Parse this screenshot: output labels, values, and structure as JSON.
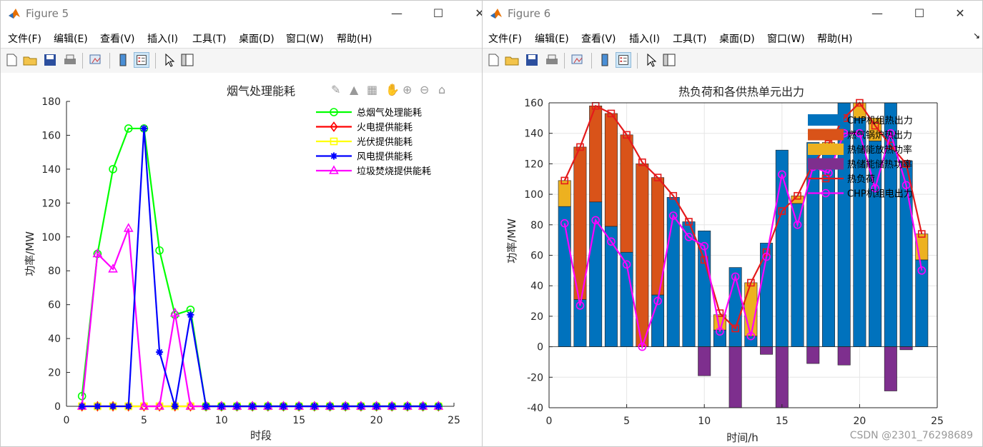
{
  "fig5": {
    "title": "Figure 5",
    "menu": [
      "文件(F)",
      "编辑(E)",
      "查看(V)",
      "插入(I)",
      "工具(T)",
      "桌面(D)",
      "窗口(W)",
      "帮助(H)"
    ],
    "chart_data": {
      "type": "line",
      "title": "烟气处理能耗",
      "xlabel": "时段",
      "ylabel": "功率/MW",
      "xlim": [
        0,
        25
      ],
      "ylim": [
        0,
        180
      ],
      "xticks": [
        0,
        5,
        10,
        15,
        20,
        25
      ],
      "yticks": [
        0,
        20,
        40,
        60,
        80,
        100,
        120,
        140,
        160,
        180
      ],
      "x": [
        1,
        2,
        3,
        4,
        5,
        6,
        7,
        8,
        9,
        10,
        11,
        12,
        13,
        14,
        15,
        16,
        17,
        18,
        19,
        20,
        21,
        22,
        23,
        24
      ],
      "series": [
        {
          "name": "总烟气处理能耗",
          "color": "#00ff00",
          "marker": "circle",
          "values": [
            6,
            90,
            140,
            164,
            164,
            92,
            54,
            57,
            0,
            0,
            0,
            0,
            0,
            0,
            0,
            0,
            0,
            0,
            0,
            0,
            0,
            0,
            0,
            0
          ]
        },
        {
          "name": "火电提供能耗",
          "color": "#ff0000",
          "marker": "diamond",
          "values": [
            0,
            0,
            0,
            0,
            0,
            0,
            0,
            0,
            0,
            0,
            0,
            0,
            0,
            0,
            0,
            0,
            0,
            0,
            0,
            0,
            0,
            0,
            0,
            0
          ]
        },
        {
          "name": "光伏提供能耗",
          "color": "#ffff00",
          "marker": "square",
          "values": [
            0,
            0,
            0,
            0,
            0,
            0,
            0,
            0,
            0,
            0,
            0,
            0,
            0,
            0,
            0,
            0,
            0,
            0,
            0,
            0,
            0,
            0,
            0,
            0
          ]
        },
        {
          "name": "风电提供能耗",
          "color": "#0000ff",
          "marker": "star",
          "values": [
            0,
            0,
            0,
            0,
            164,
            32,
            0,
            54,
            0,
            0,
            0,
            0,
            0,
            0,
            0,
            0,
            0,
            0,
            0,
            0,
            0,
            0,
            0,
            0
          ]
        },
        {
          "name": "垃圾焚烧提供能耗",
          "color": "#ff00ff",
          "marker": "triangle",
          "values": [
            0,
            90,
            81,
            105,
            0,
            0,
            55,
            0,
            0,
            0,
            0,
            0,
            0,
            0,
            0,
            0,
            0,
            0,
            0,
            0,
            0,
            0,
            0,
            0
          ]
        }
      ],
      "legend_position": "top-right",
      "grid": false
    }
  },
  "fig6": {
    "title": "Figure 6",
    "menu": [
      "文件(F)",
      "编辑(E)",
      "查看(V)",
      "插入(I)",
      "工具(T)",
      "桌面(D)",
      "窗口(W)",
      "帮助(H)"
    ],
    "chart_data": {
      "type": "bar",
      "title": "热负荷和各供热单元出力",
      "xlabel": "时间/h",
      "ylabel": "功率/MW",
      "xlim": [
        0,
        25
      ],
      "ylim": [
        -40,
        160
      ],
      "xticks": [
        0,
        5,
        10,
        15,
        20,
        25
      ],
      "yticks": [
        -40,
        -20,
        0,
        20,
        40,
        60,
        80,
        100,
        120,
        140,
        160
      ],
      "x": [
        1,
        2,
        3,
        4,
        5,
        6,
        7,
        8,
        9,
        10,
        11,
        12,
        13,
        14,
        15,
        16,
        17,
        18,
        19,
        20,
        21,
        22,
        23,
        24
      ],
      "stacked_series": [
        {
          "name": "CHP机组热出力",
          "color": "#0072bd",
          "values": [
            92,
            31,
            95,
            79,
            62,
            0,
            34,
            98,
            82,
            76,
            11,
            52,
            7,
            68,
            129,
            94,
            134,
            130,
            160,
            150,
            135,
            160,
            122,
            57
          ]
        },
        {
          "name": "燃气锅炉热出力",
          "color": "#d95319",
          "values": [
            0,
            100,
            63,
            74,
            77,
            120,
            77,
            0,
            0,
            0,
            0,
            0,
            0,
            0,
            0,
            0,
            0,
            0,
            0,
            0,
            0,
            0,
            0,
            0
          ]
        },
        {
          "name": "热储能放热功率",
          "color": "#edb120",
          "values": [
            17,
            0,
            0,
            0,
            0,
            0,
            0,
            0,
            0,
            0,
            10,
            0,
            35,
            0,
            0,
            5,
            0,
            4,
            0,
            10,
            15,
            0,
            0,
            17
          ]
        },
        {
          "name": "热储能储热功率",
          "color": "#7e2f8e",
          "values": [
            0,
            0,
            0,
            0,
            0,
            0,
            0,
            0,
            0,
            -19,
            0,
            -40,
            0,
            -5,
            -40,
            0,
            -11,
            0,
            -12,
            0,
            0,
            -29,
            -2,
            0
          ]
        }
      ],
      "line_series": [
        {
          "name": "热负荷",
          "color": "#e41a1c",
          "marker": "square",
          "values": [
            109,
            131,
            158,
            153,
            139,
            121,
            111,
            99,
            82,
            57,
            22,
            12,
            42,
            62,
            89,
            99,
            120,
            133,
            150,
            160,
            145,
            132,
            120,
            74
          ]
        },
        {
          "name": "CHP机组电出力",
          "color": "#ff00ff",
          "marker": "circle",
          "values": [
            81,
            27,
            83,
            69,
            54,
            0,
            30,
            86,
            72,
            66,
            10,
            46,
            7,
            59,
            113,
            80,
            118,
            114,
            140,
            140,
            104,
            140,
            106,
            50
          ]
        }
      ],
      "legend_position": "top-right",
      "grid": true,
      "watermark": "CSDN @2301_76298689"
    }
  }
}
